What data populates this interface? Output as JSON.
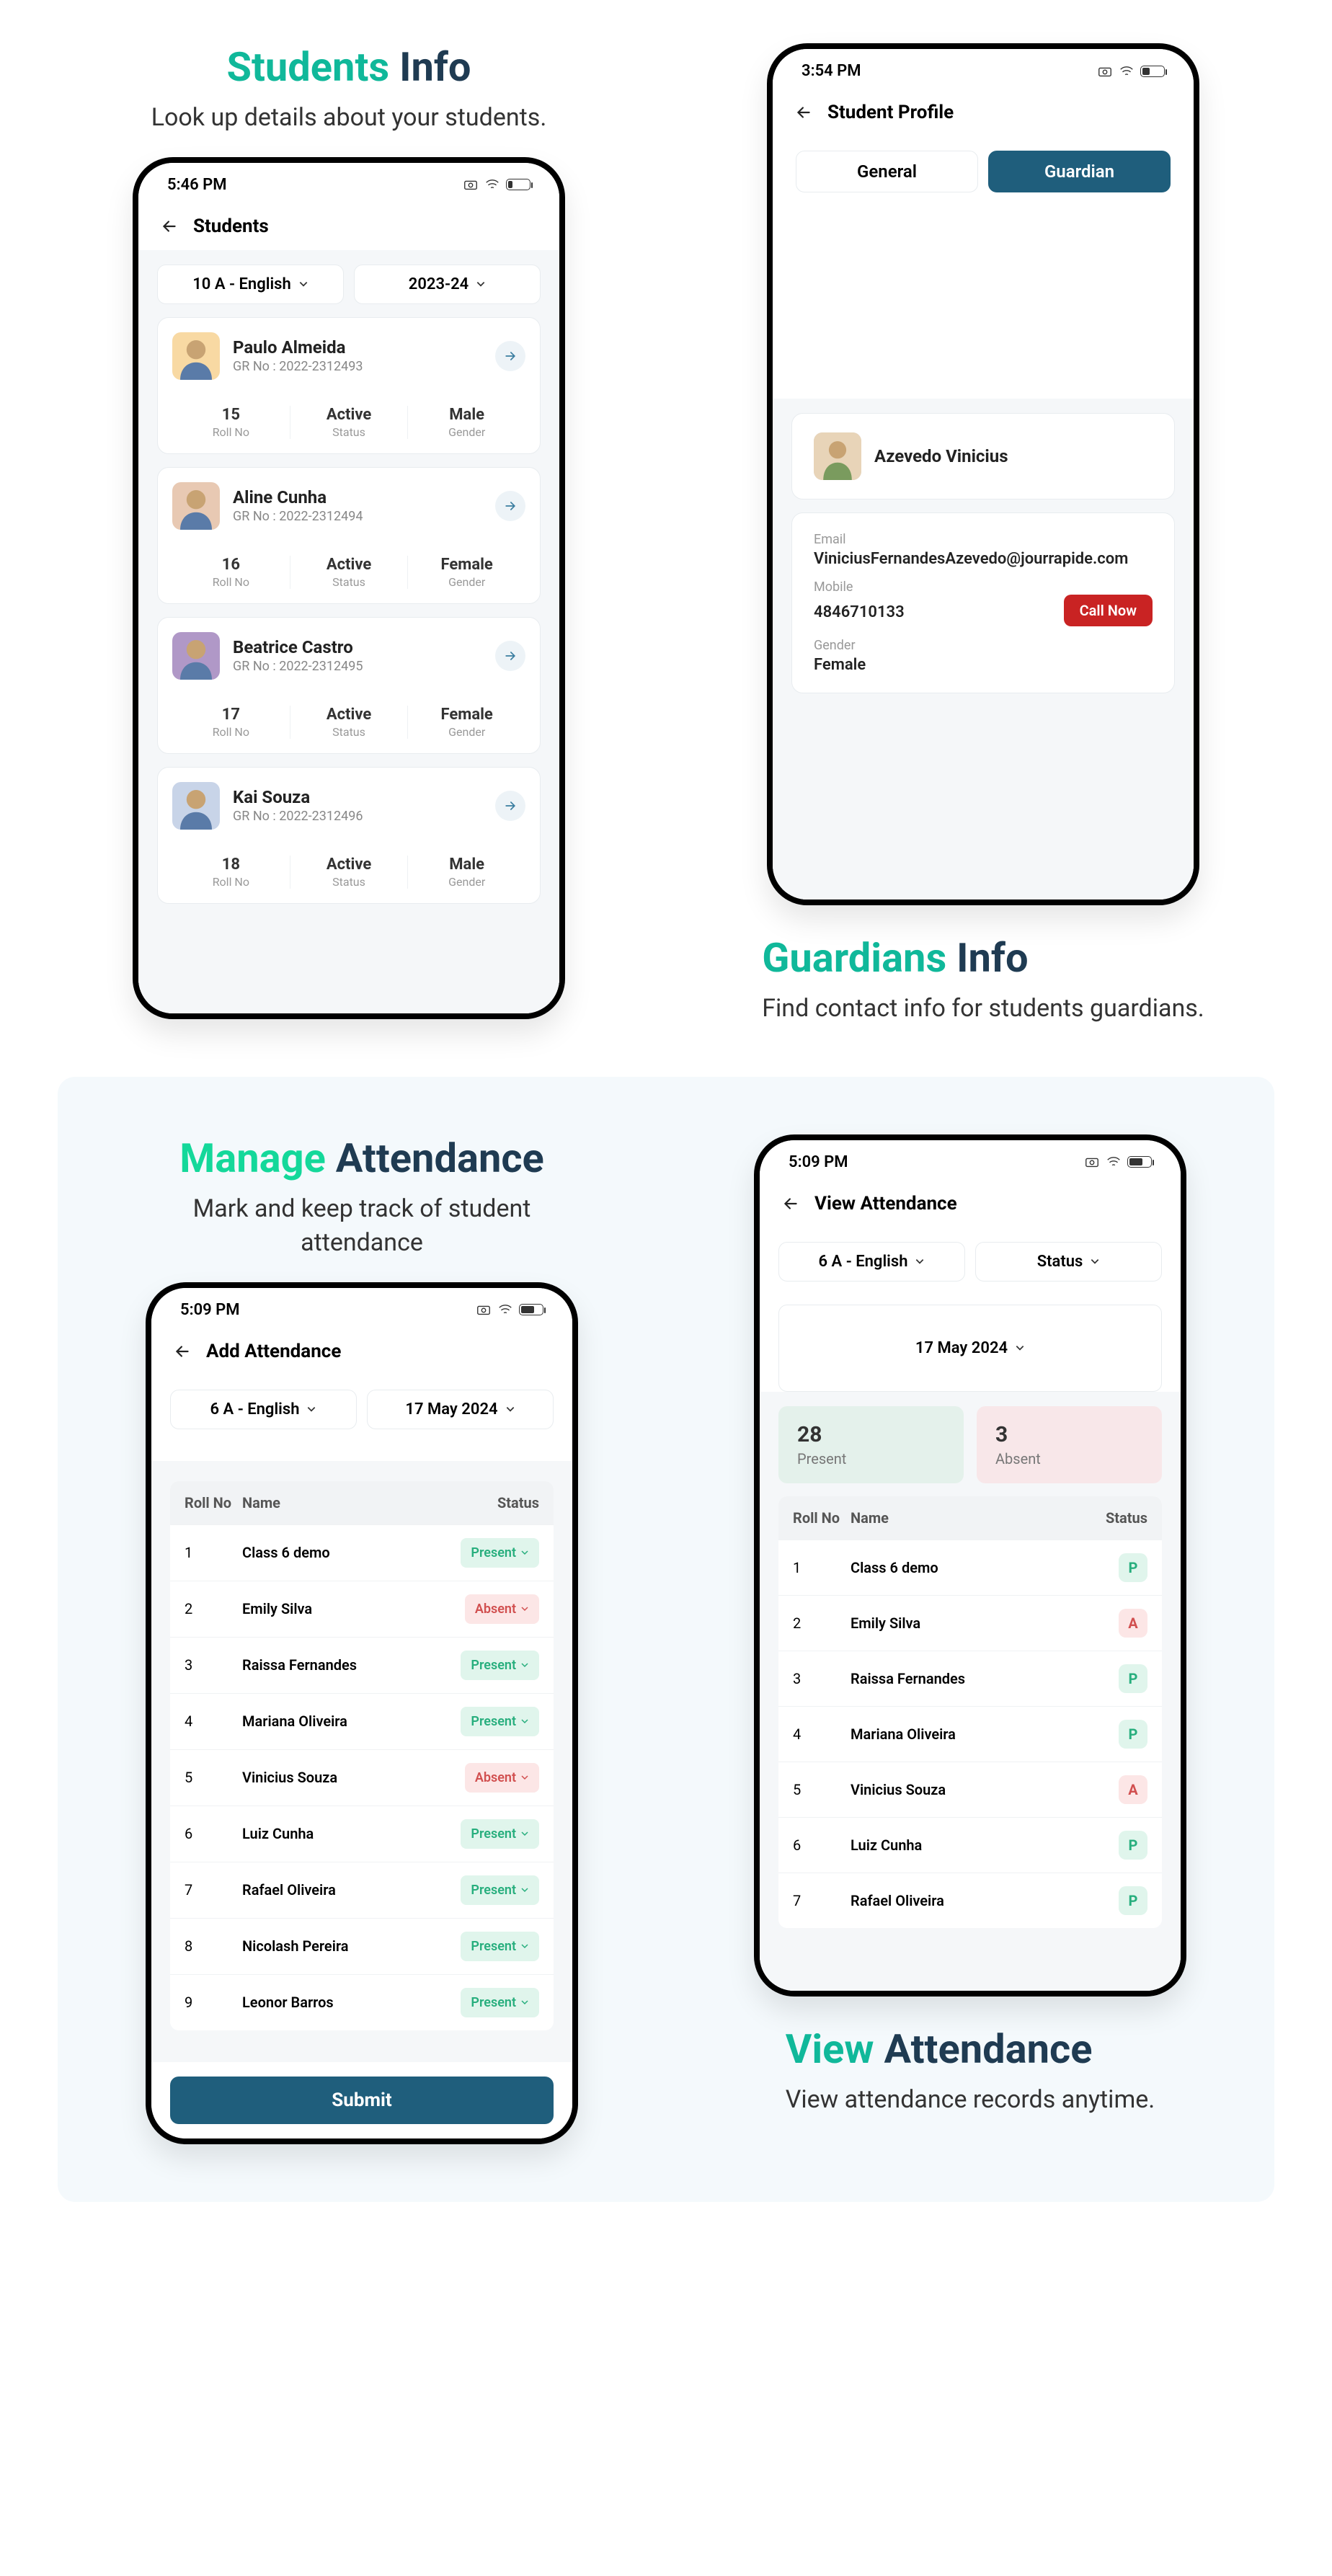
{
  "features": {
    "students": {
      "title_accent": "Students",
      "title_rest": "Info",
      "subtitle": "Look up details about your students."
    },
    "guardians": {
      "title_accent": "Guardians",
      "title_rest": "Info",
      "subtitle": "Find contact info for students guardians."
    },
    "manage": {
      "title_accent": "Manage",
      "title_rest": "Attendance",
      "subtitle": "Mark and keep track of  student attendance"
    },
    "view": {
      "title_accent": "View",
      "title_rest": "Attendance",
      "subtitle": "View attendance records anytime."
    }
  },
  "screen1": {
    "time": "5:46 PM",
    "battery": "20",
    "title": "Students",
    "class_selector": "10 A - English",
    "year_selector": "2023-24",
    "students": [
      {
        "name": "Paulo Almeida",
        "gr": "GR No : 2022-2312493",
        "roll": "15",
        "status": "Active",
        "gender": "Male"
      },
      {
        "name": "Aline Cunha",
        "gr": "GR No : 2022-2312494",
        "roll": "16",
        "status": "Active",
        "gender": "Female"
      },
      {
        "name": "Beatrice Castro",
        "gr": "GR No : 2022-2312495",
        "roll": "17",
        "status": "Active",
        "gender": "Female"
      },
      {
        "name": "Kai Souza",
        "gr": "GR No : 2022-2312496",
        "roll": "18",
        "status": "Active",
        "gender": "Male"
      }
    ],
    "labels": {
      "roll": "Roll No",
      "status": "Status",
      "gender": "Gender"
    }
  },
  "screen2": {
    "time": "3:54 PM",
    "battery": "37",
    "title": "Student Profile",
    "tabs": {
      "general": "General",
      "guardian": "Guardian"
    },
    "guardian_name": "Azevedo Vinicius",
    "email_label": "Email",
    "email": "ViniciusFernandesAzevedo@jourrapide.com",
    "mobile_label": "Mobile",
    "mobile": "4846710133",
    "gender_label": "Gender",
    "gender": "Female",
    "call_button": "Call Now"
  },
  "screen3": {
    "time": "5:09 PM",
    "battery": "66",
    "title": "Add Attendance",
    "class_selector": "6 A - English",
    "date_selector": "17 May 2024",
    "headers": {
      "roll": "Roll No",
      "name": "Name",
      "status": "Status"
    },
    "rows": [
      {
        "roll": "1",
        "name": "Class 6 demo",
        "status": "Present"
      },
      {
        "roll": "2",
        "name": "Emily Silva",
        "status": "Absent"
      },
      {
        "roll": "3",
        "name": "Raissa Fernandes",
        "status": "Present"
      },
      {
        "roll": "4",
        "name": "Mariana Oliveira",
        "status": "Present"
      },
      {
        "roll": "5",
        "name": "Vinicius Souza",
        "status": "Absent"
      },
      {
        "roll": "6",
        "name": "Luiz Cunha",
        "status": "Present"
      },
      {
        "roll": "7",
        "name": "Rafael Oliveira",
        "status": "Present"
      },
      {
        "roll": "8",
        "name": "Nicolash Pereira",
        "status": "Present"
      },
      {
        "roll": "9",
        "name": "Leonor Barros",
        "status": "Present"
      }
    ],
    "submit": "Submit"
  },
  "screen4": {
    "time": "5:09 PM",
    "battery": "66",
    "title": "View Attendance",
    "class_selector": "6 A - English",
    "status_selector": "Status",
    "date_selector": "17 May 2024",
    "present_count": "28",
    "present_label": "Present",
    "absent_count": "3",
    "absent_label": "Absent",
    "headers": {
      "roll": "Roll No",
      "name": "Name",
      "status": "Status"
    },
    "rows": [
      {
        "roll": "1",
        "name": "Class 6 demo",
        "status": "P"
      },
      {
        "roll": "2",
        "name": "Emily Silva",
        "status": "A"
      },
      {
        "roll": "3",
        "name": "Raissa Fernandes",
        "status": "P"
      },
      {
        "roll": "4",
        "name": "Mariana Oliveira",
        "status": "P"
      },
      {
        "roll": "5",
        "name": "Vinicius Souza",
        "status": "A"
      },
      {
        "roll": "6",
        "name": "Luiz Cunha",
        "status": "P"
      },
      {
        "roll": "7",
        "name": "Rafael Oliveira",
        "status": "P"
      }
    ]
  }
}
